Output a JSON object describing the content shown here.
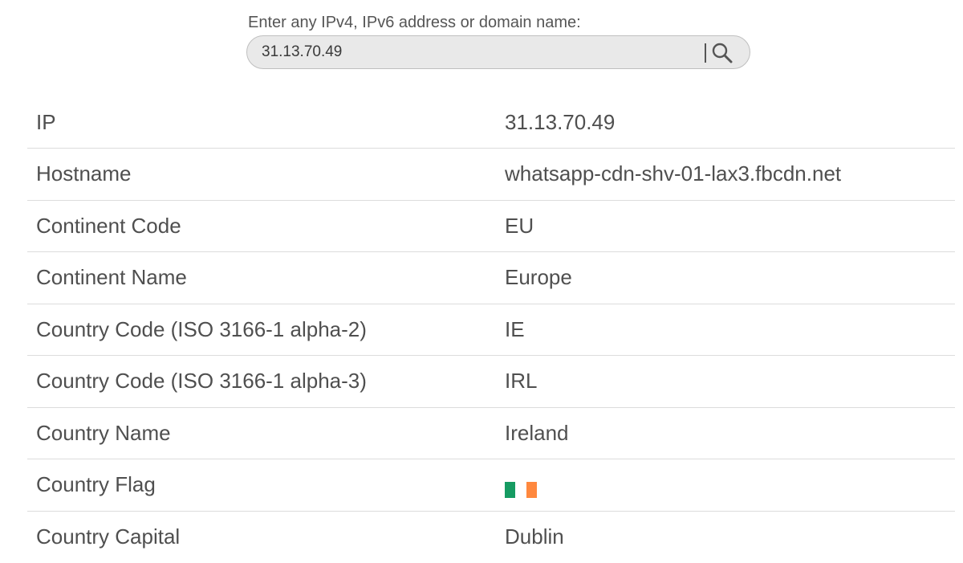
{
  "search": {
    "label": "Enter any IPv4, IPv6 address or domain name:",
    "value": "31.13.70.49",
    "button_icon": "search-icon"
  },
  "rows": [
    {
      "label": "IP",
      "value": "31.13.70.49"
    },
    {
      "label": "Hostname",
      "value": "whatsapp-cdn-shv-01-lax3.fbcdn.net"
    },
    {
      "label": "Continent Code",
      "value": "EU"
    },
    {
      "label": "Continent Name",
      "value": "Europe"
    },
    {
      "label": "Country Code (ISO 3166-1 alpha-2)",
      "value": "IE"
    },
    {
      "label": "Country Code (ISO 3166-1 alpha-3)",
      "value": "IRL"
    },
    {
      "label": "Country Name",
      "value": "Ireland"
    },
    {
      "label": "Country Flag",
      "value": ""
    },
    {
      "label": "Country Capital",
      "value": "Dublin"
    }
  ],
  "flag": {
    "icon": "ireland-flag-icon",
    "colors": [
      "#169b62",
      "#ffffff",
      "#ff883e"
    ]
  }
}
